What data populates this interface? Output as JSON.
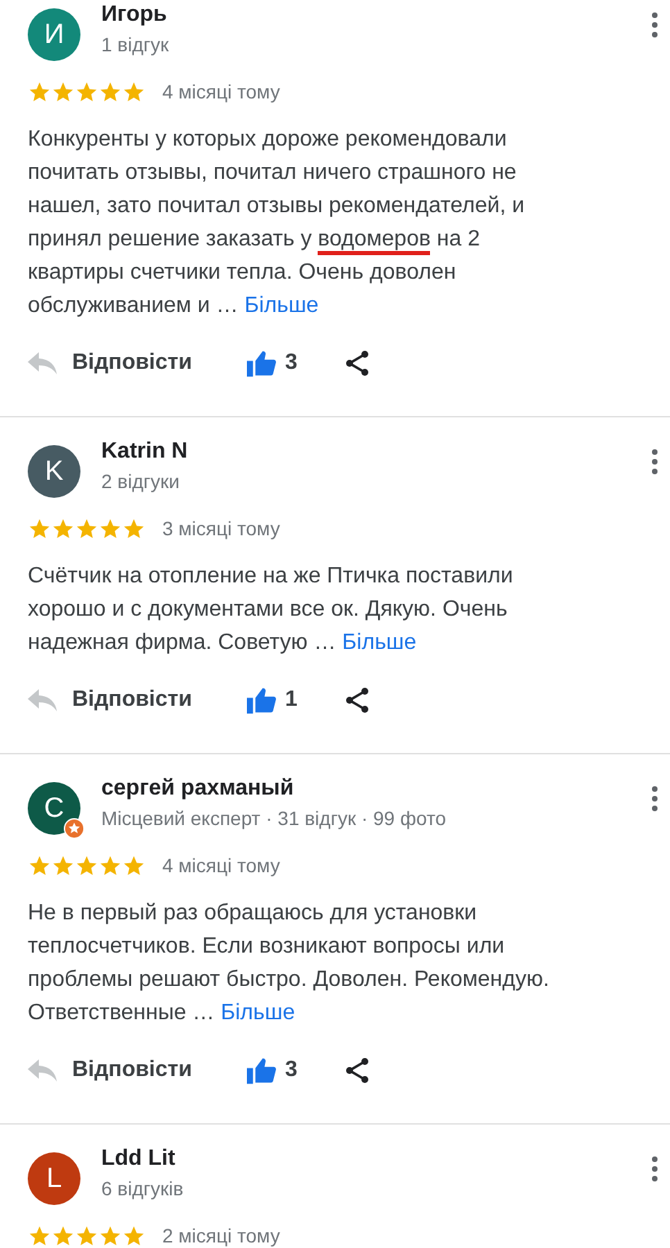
{
  "reviews": [
    {
      "initial": "И",
      "color": "#13897a",
      "badge": false,
      "name": "Игорь",
      "meta": "1 відгук",
      "stars": 5,
      "date": "4 місяці тому",
      "body": [
        {
          "text": "Конкуренты у которых дороже рекомендовали почитать отзывы, почитал ничего страшного не нашел, зато почитал отзывы рекомендателей, и принял решение заказать у ",
          "marked": false
        },
        {
          "text": "водомеров",
          "marked": true
        },
        {
          "text": " на 2 квартиры счетчики тепла. Очень доволен обслуживанием и …",
          "marked": false
        }
      ],
      "more": "Більше",
      "reply": "Відповісти",
      "likes": "3",
      "liked": true
    },
    {
      "initial": "K",
      "color": "#475b63",
      "badge": false,
      "name": "Katrin N",
      "meta": "2 відгуки",
      "stars": 5,
      "date": "3 місяці тому",
      "body": [
        {
          "text": "Счётчик на отопление на же Птичка поставили хорошо и с документами все ок. Дякую. Очень надежная фирма. Советую …",
          "marked": false
        }
      ],
      "more": "Більше",
      "reply": "Відповісти",
      "likes": "1",
      "liked": true
    },
    {
      "initial": "С",
      "color": "#0e5a48",
      "badge": true,
      "name": "сергей рахманый",
      "meta": "Місцевий експерт · 31 відгук · 99 фото",
      "stars": 5,
      "date": "4 місяці тому",
      "body": [
        {
          "text": "Не в первый раз обращаюсь для установки теплосчетчиков. Если возникают вопросы или проблемы решают быстро. Доволен. Рекомендую. Ответственные …",
          "marked": false
        }
      ],
      "more": "Більше",
      "reply": "Відповісти",
      "likes": "3",
      "liked": true
    },
    {
      "initial": "L",
      "color": "#bf3a10",
      "badge": false,
      "name": "Ldd Lit",
      "meta": "6 відгуків",
      "stars": 5,
      "date": "2 місяці тому"
    }
  ]
}
